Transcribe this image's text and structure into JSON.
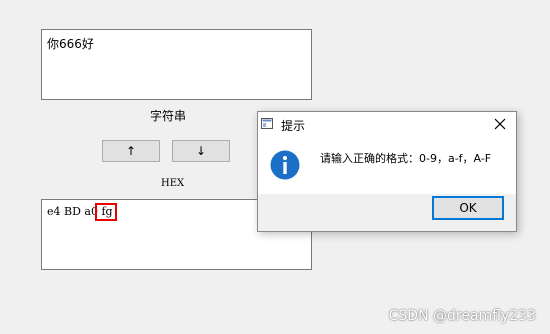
{
  "main": {
    "input_text": "你666好",
    "string_label": "字符串",
    "up_button_label": "↑",
    "down_button_label": "↓",
    "hex_label": "HEX",
    "hex_text": "e4 BD a0 fg"
  },
  "dialog": {
    "title": "提示",
    "message": "请输入正确的格式：0-9，a-f，A-F",
    "ok_label": "OK",
    "icon": "info-icon",
    "highlight_color": "#e60000",
    "accent_color": "#0078d7"
  },
  "watermark": "CSDN @dreamfly233"
}
